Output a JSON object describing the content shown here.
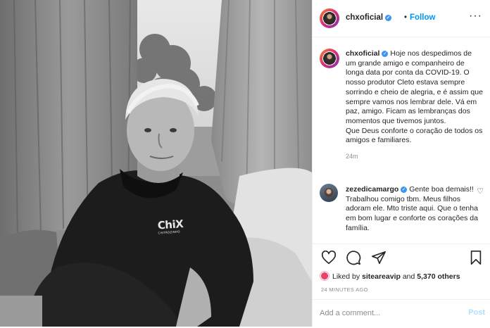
{
  "post": {
    "photo_logo": "ChiX",
    "account": "chxoficial",
    "follow_label": "Follow",
    "separator": "•"
  },
  "caption": {
    "username": "chxoficial",
    "text": "Hoje nos despedimos de um grande amigo e companheiro de longa data por conta da COVID-19. O nosso produtor Cleto estava sempre sorrindo e cheio de alegria, e é assim que sempre vamos nos lembrar dele. Vá em paz, amigo. Ficam as lembranças dos momentos que tivemos juntos.\nQue Deus conforte o coração de todos os amigos e familiares.",
    "time": "24m"
  },
  "comment": {
    "username": "zezedicamargo",
    "text": "Gente boa demais!! Trabalhou comigo tbm. Meus filhos adoram ele. Mto triste aqui. Que o tenha em bom lugar e conforte os corações da família."
  },
  "likes": {
    "prefix": "Liked by",
    "first": "sitearea​vip",
    "and": "and",
    "others": "5,370 others"
  },
  "timestamp": "24 MINUTES AGO",
  "add_comment": {
    "placeholder": "Add a comment...",
    "post_label": "Post"
  },
  "icons": [
    "more-icon",
    "heart-icon",
    "comment-icon",
    "share-icon",
    "bookmark-icon",
    "verified-icon"
  ],
  "colors": {
    "link": "#0095f6",
    "verified": "#3897f0",
    "text": "#262626",
    "muted": "#8e8e8e"
  }
}
